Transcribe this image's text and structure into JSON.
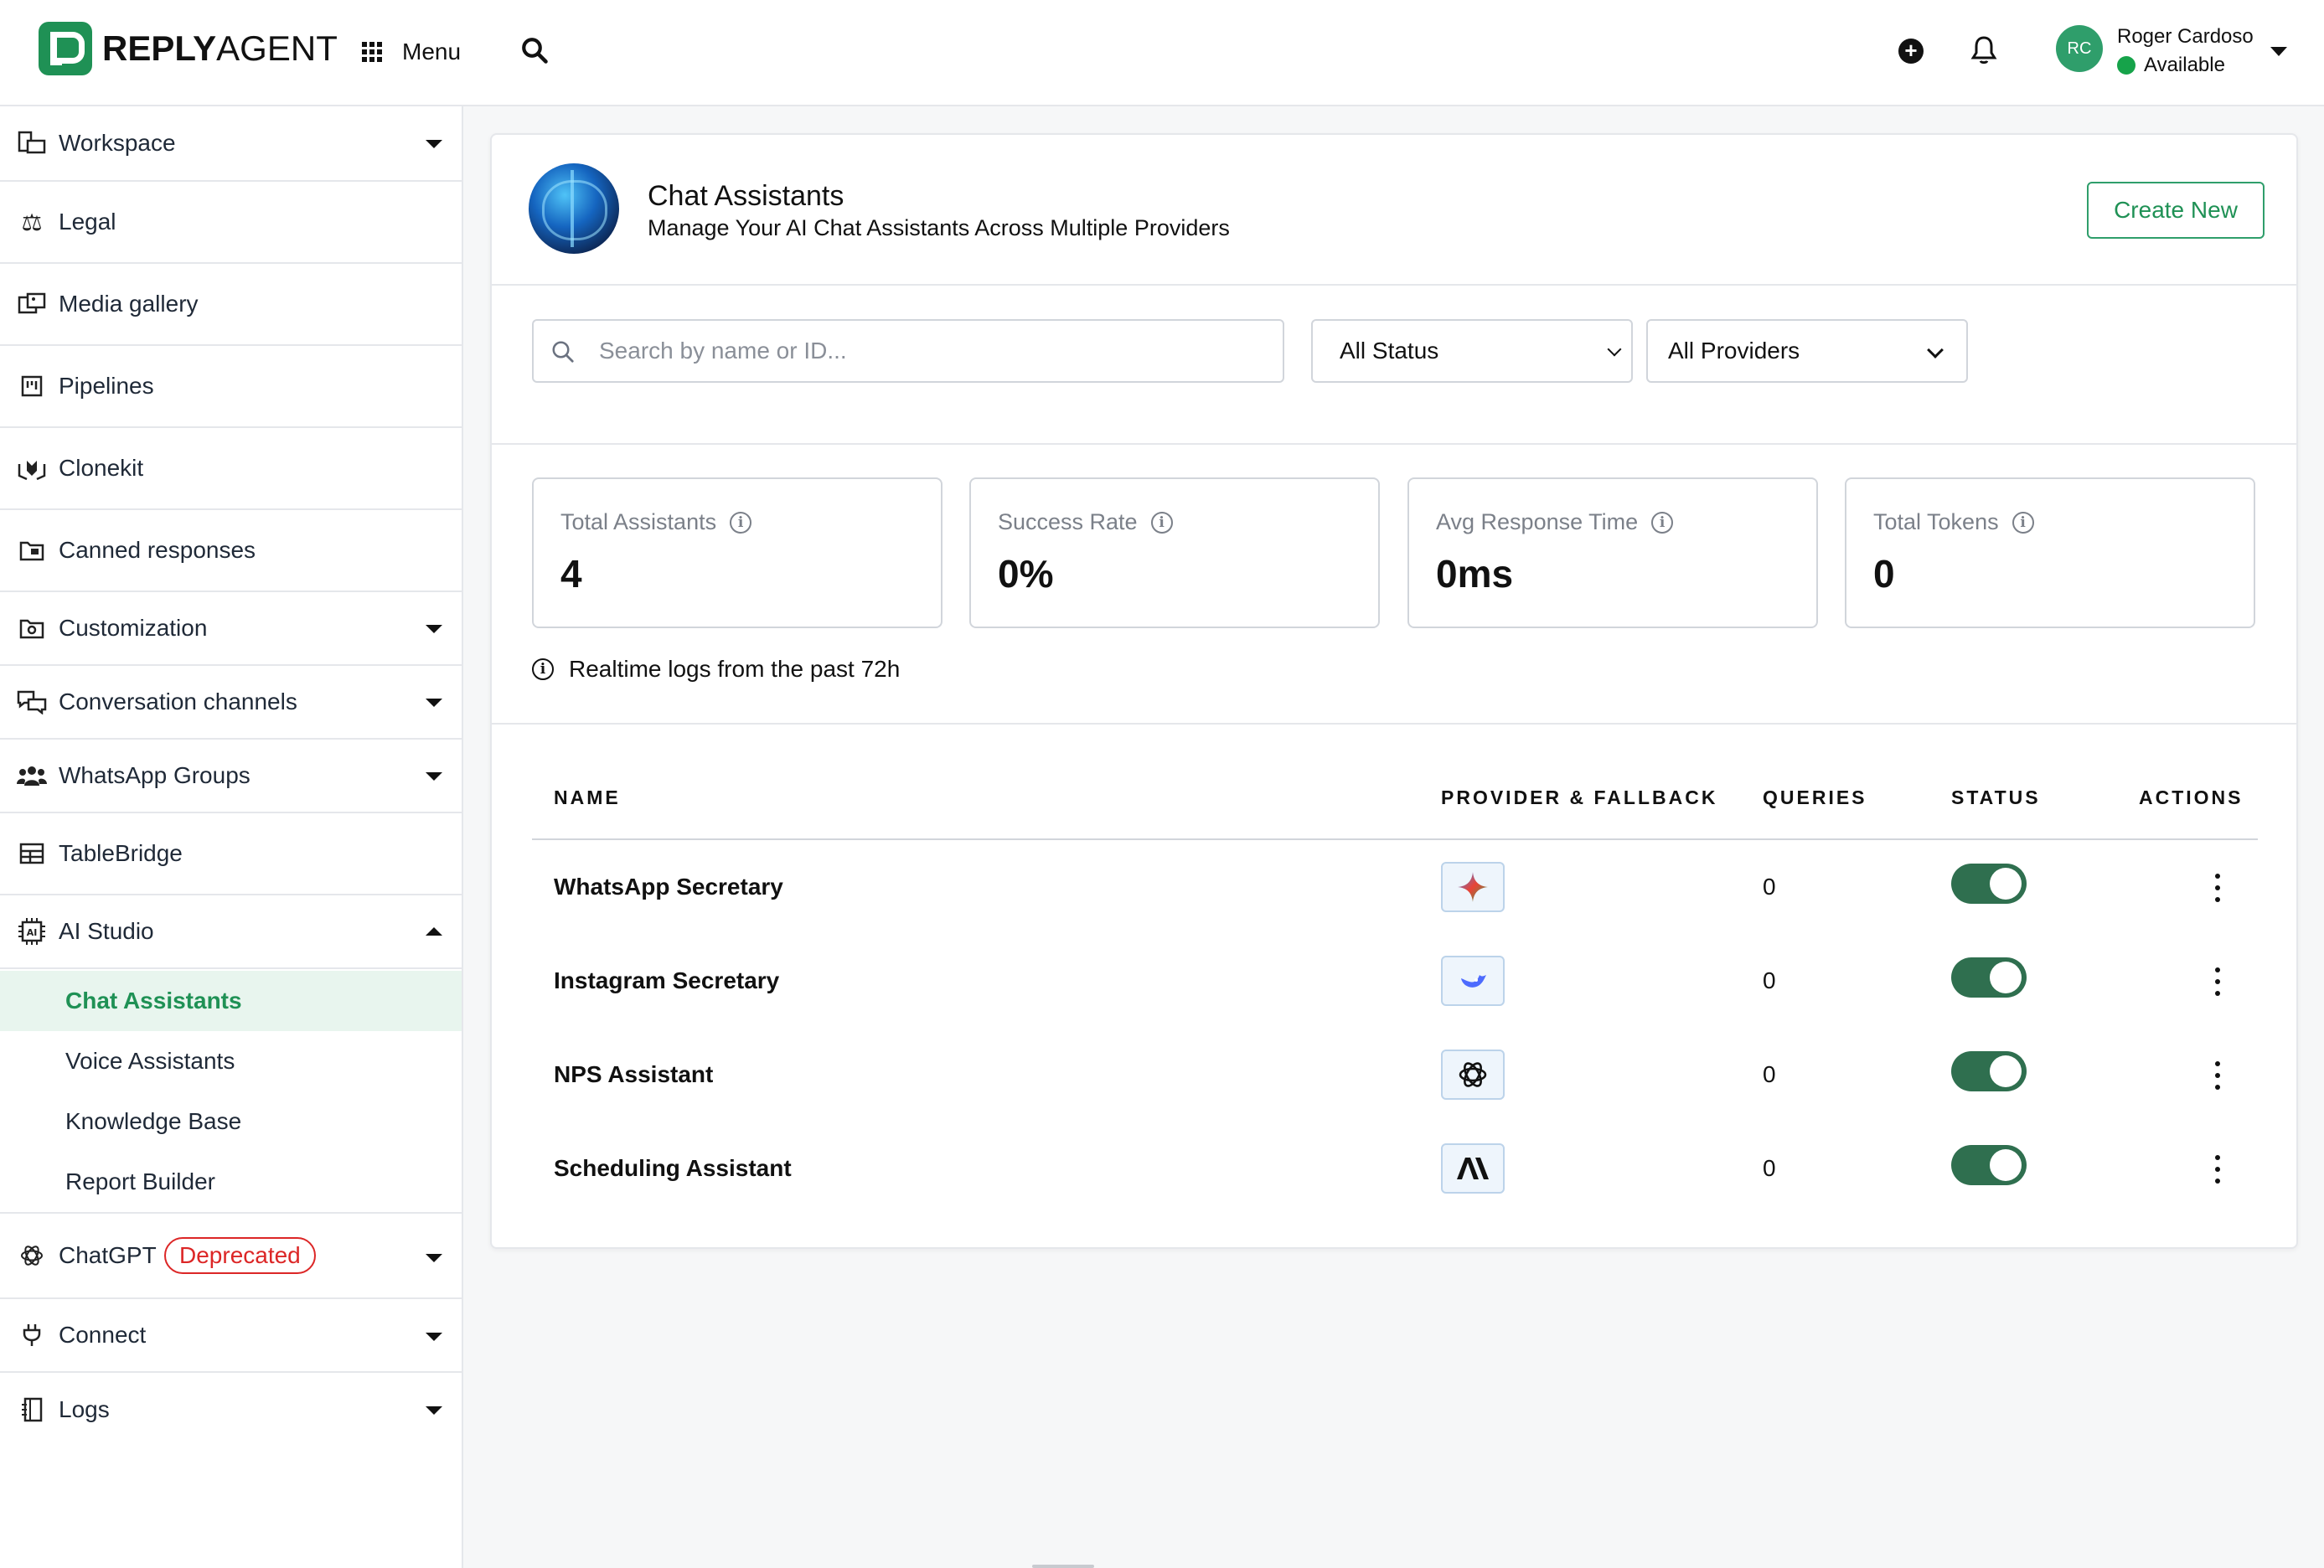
{
  "app": {
    "logo_bold": "REPLY",
    "logo_light": "AGENT",
    "menu_label": "Menu"
  },
  "user": {
    "initials": "RC",
    "name": "Roger Cardoso",
    "status": "Available"
  },
  "sidebar": {
    "items": [
      {
        "label": "Workspace"
      },
      {
        "label": "Legal"
      },
      {
        "label": "Media gallery"
      },
      {
        "label": "Pipelines"
      },
      {
        "label": "Clonekit"
      },
      {
        "label": "Canned responses"
      },
      {
        "label": "Customization"
      },
      {
        "label": "Conversation channels"
      },
      {
        "label": "WhatsApp Groups"
      },
      {
        "label": "TableBridge"
      },
      {
        "label": "AI Studio"
      },
      {
        "label": "ChatGPT",
        "badge": "Deprecated"
      },
      {
        "label": "Connect"
      },
      {
        "label": "Logs"
      }
    ],
    "ai_studio_sub": [
      {
        "label": "Chat Assistants"
      },
      {
        "label": "Voice Assistants"
      },
      {
        "label": "Knowledge Base"
      },
      {
        "label": "Report Builder"
      }
    ]
  },
  "page": {
    "title": "Chat Assistants",
    "subtitle": "Manage Your AI Chat Assistants Across Multiple Providers",
    "create_label": "Create New"
  },
  "filters": {
    "search_placeholder": "Search by name or ID...",
    "status_selected": "All Status",
    "provider_selected": "All Providers"
  },
  "stats": [
    {
      "label": "Total Assistants",
      "value": "4"
    },
    {
      "label": "Success Rate",
      "value": "0%"
    },
    {
      "label": "Avg Response Time",
      "value": "0ms"
    },
    {
      "label": "Total Tokens",
      "value": "0"
    }
  ],
  "realtime_note": "Realtime logs from the past 72h",
  "table": {
    "headers": [
      "NAME",
      "PROVIDER & FALLBACK",
      "QUERIES",
      "STATUS",
      "ACTIONS"
    ],
    "rows": [
      {
        "name": "WhatsApp Secretary",
        "provider_icon": "gemini-icon",
        "queries": "0",
        "active": true
      },
      {
        "name": "Instagram Secretary",
        "provider_icon": "deepseek-icon",
        "queries": "0",
        "active": true
      },
      {
        "name": "NPS Assistant",
        "provider_icon": "openai-icon",
        "queries": "0",
        "active": true
      },
      {
        "name": "Scheduling Assistant",
        "provider_icon": "anthropic-icon",
        "queries": "0",
        "active": true
      }
    ]
  },
  "colors": {
    "brand_green": "#1f9155",
    "toggle_on": "#2f6f4f",
    "deprecated_red": "#dc2626"
  }
}
